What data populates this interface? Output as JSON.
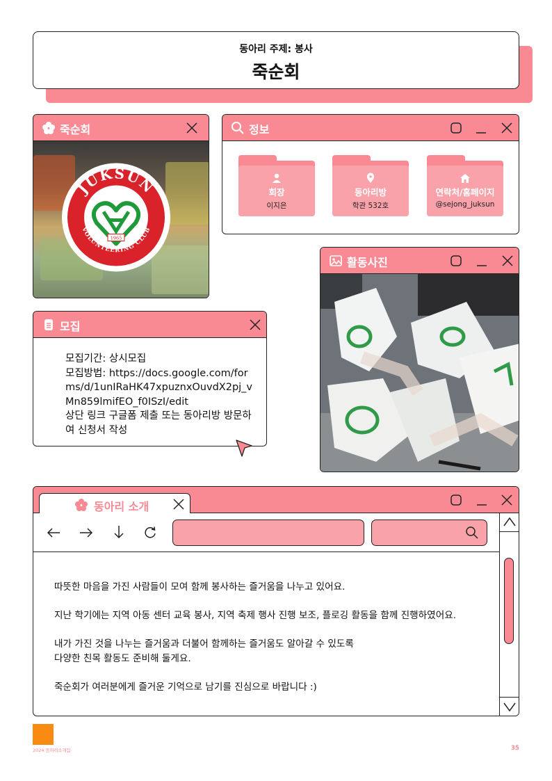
{
  "header": {
    "subtitle": "동아리 주제: 봉사",
    "title": "죽순회"
  },
  "logo_window": {
    "title": "죽순회",
    "logo_text_top": "JUKSUN",
    "logo_text_bottom": "VOLUNTEERING CLUB",
    "logo_year": "1965"
  },
  "info_window": {
    "title": "정보",
    "folders": [
      {
        "icon": "person-icon",
        "title": "회장",
        "value": "이지은"
      },
      {
        "icon": "location-pin-icon",
        "title": "동아리방",
        "value": "학관 532호"
      },
      {
        "icon": "home-icon",
        "title": "연락처/홈페이지",
        "value": "@sejong_juksun"
      }
    ]
  },
  "recruit_window": {
    "title": "모집",
    "lines": [
      "모집기간: 상시모집",
      "모집방법: https://docs.google.com/forms/d/1unIRaHK47xpuznxOuvdX2pj_vMn859lmifEO_f0ISzI/edit",
      "상단 링크 구글폼 제출 또는 동아리방 방문하여 신청서 작성"
    ]
  },
  "photo_window": {
    "title": "활동사진"
  },
  "intro_window": {
    "tab_label": "동아리 소개",
    "paragraphs": [
      "따뜻한 마음을 가진 사람들이 모여 함께 봉사하는 즐거움을 나누고 있어요.",
      "지난 학기에는 지역 아동 센터 교육 봉사, 지역 축제 행사 진행 보조, 플로깅 활동을 함께 진행하였어요.",
      "내가 가진 것을 나누는 즐거움과 더불어 함께하는 즐거움도 알아갈 수 있도록\n다양한 친목 활동도 준비해 둘게요.",
      "죽순회가 여러분에게 즐거운 기억으로 남기를 진심으로 바랍니다 :)"
    ]
  },
  "footer": {
    "label": "2024 동아리소개집",
    "page": "35"
  },
  "colors": {
    "accent": "#f98a94",
    "accent_light": "#f9a2a9",
    "orange": "#f98b12"
  }
}
